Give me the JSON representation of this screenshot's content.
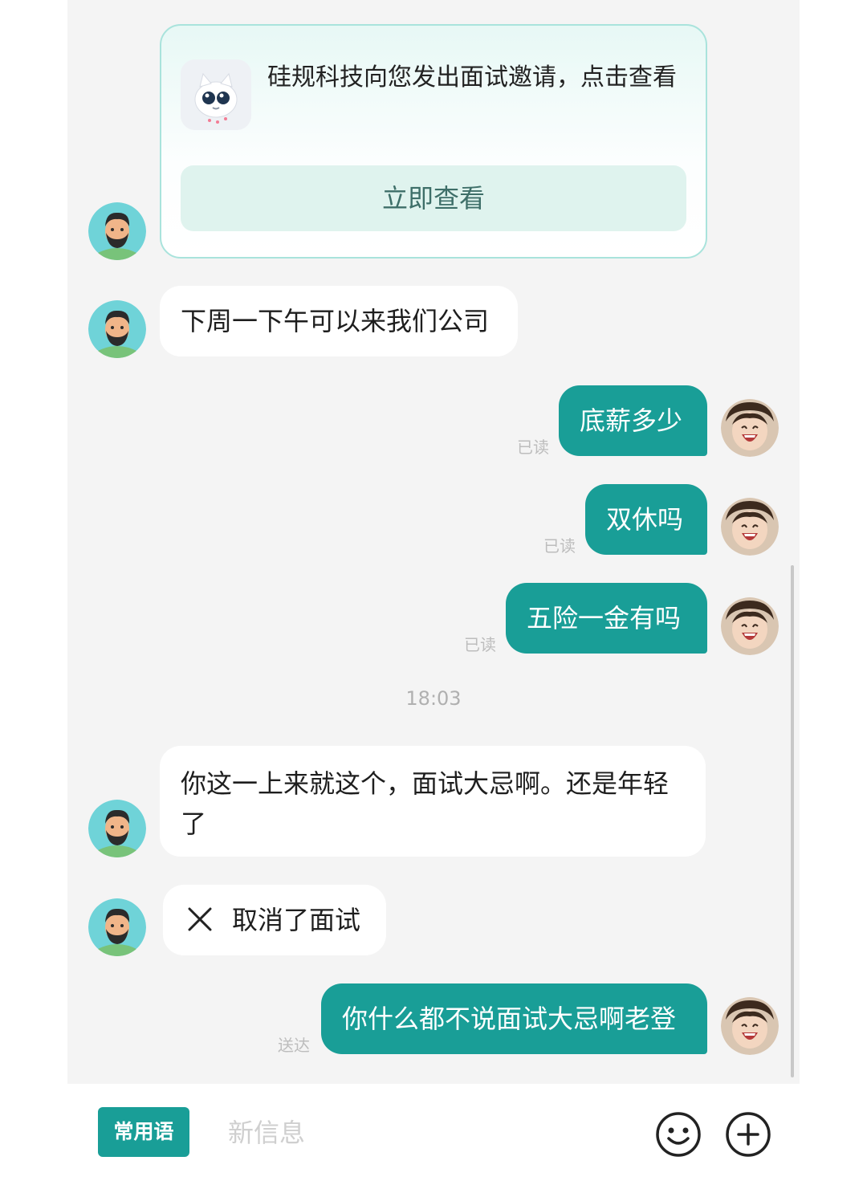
{
  "invite_card": {
    "text": "硅规科技向您发出面试邀请，点击查看",
    "button_label": "立即查看"
  },
  "messages": [
    {
      "from": "recruiter",
      "text": "下周一下午可以来我们公司"
    },
    {
      "from": "me",
      "text": "底薪多少",
      "status": "已读"
    },
    {
      "from": "me",
      "text": "双休吗",
      "status": "已读"
    },
    {
      "from": "me",
      "text": "五险一金有吗",
      "status": "已读"
    },
    {
      "from": "recruiter",
      "text": "你这一上来就这个，面试大忌啊。还是年轻了"
    },
    {
      "from": "recruiter",
      "text": "取消了面试",
      "icon": "cross-icon"
    },
    {
      "from": "me",
      "text": "你什么都不说面试大忌啊老登",
      "status": "送达"
    }
  ],
  "timestamp": "18:03",
  "bottom_bar": {
    "quick_phrases_label": "常用语",
    "input_placeholder": "新信息",
    "emoji_icon": "smiley-icon",
    "plus_icon": "plus-circle-icon"
  },
  "colors": {
    "accent": "#199e97",
    "chat_background": "#f4f4f4",
    "incoming_bubble": "#ffffff"
  }
}
